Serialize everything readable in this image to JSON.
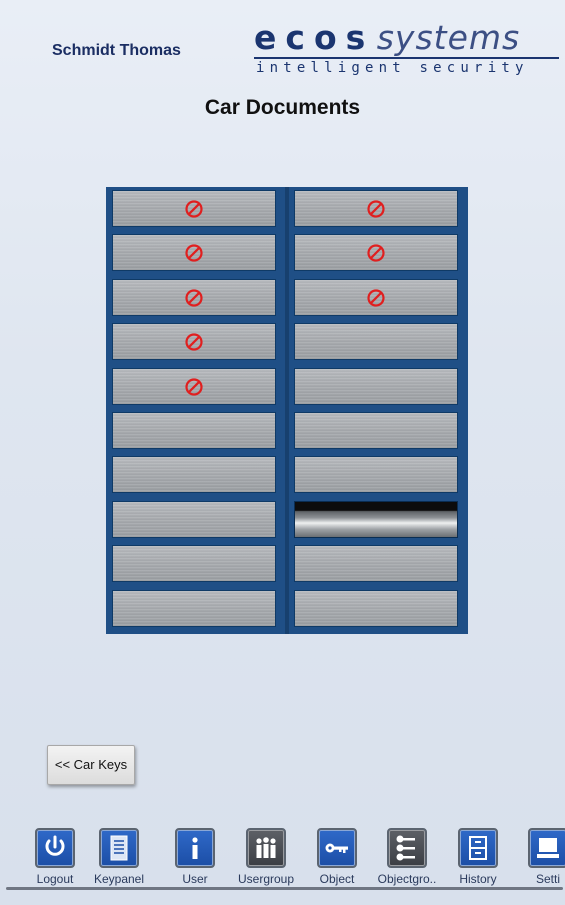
{
  "header": {
    "user_name": "Schmidt Thomas",
    "logo_word": "ecos",
    "logo_word2": "systems",
    "logo_tagline": "intelligent security"
  },
  "page_title": "Car Documents",
  "locker": {
    "left_column": [
      {
        "status": "blocked"
      },
      {
        "status": "blocked"
      },
      {
        "status": "blocked"
      },
      {
        "status": "blocked"
      },
      {
        "status": "blocked"
      },
      {
        "status": "empty"
      },
      {
        "status": "empty"
      },
      {
        "status": "empty"
      },
      {
        "status": "empty"
      },
      {
        "status": "empty"
      }
    ],
    "right_column": [
      {
        "status": "blocked"
      },
      {
        "status": "blocked"
      },
      {
        "status": "blocked"
      },
      {
        "status": "empty"
      },
      {
        "status": "empty"
      },
      {
        "status": "empty"
      },
      {
        "status": "empty"
      },
      {
        "status": "open"
      },
      {
        "status": "empty"
      },
      {
        "status": "empty"
      }
    ],
    "blocked_color": "#e01f1f"
  },
  "back_button_label": "<< Car Keys",
  "nav": [
    {
      "label": "Logout",
      "icon": "power-icon"
    },
    {
      "label": "Keypanel",
      "icon": "keypanel-icon"
    },
    {
      "label": "User",
      "icon": "info-icon"
    },
    {
      "label": "Usergroup",
      "icon": "usergroup-icon"
    },
    {
      "label": "Object",
      "icon": "key-icon"
    },
    {
      "label": "Objectgro..",
      "icon": "keys-icon"
    },
    {
      "label": "History",
      "icon": "cabinet-icon"
    },
    {
      "label": "Setti",
      "icon": "settings-icon"
    }
  ],
  "colors": {
    "brand": "#1b3570",
    "nav_blue": "#1c4ea6"
  }
}
